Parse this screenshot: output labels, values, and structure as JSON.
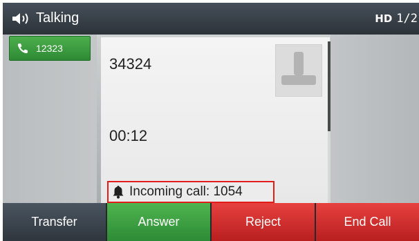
{
  "status_bar": {
    "speaker_icon": "speaker-icon",
    "title": "Talking",
    "hd_label": "HD",
    "page_indicator": "1/2"
  },
  "line_key": {
    "icon": "phone-icon",
    "label": "12323",
    "color": "#3a9d40"
  },
  "call": {
    "callee_number": "34324",
    "duration": "00:12",
    "avatar_icon": "contact-avatar-icon"
  },
  "incoming": {
    "icon": "bell-icon",
    "text": "Incoming call: 1054",
    "highlight_color": "#e21b1b"
  },
  "softkeys": [
    {
      "label": "Transfer",
      "color": "#3a434c"
    },
    {
      "label": "Answer",
      "color": "#3a9d40"
    },
    {
      "label": "Reject",
      "color": "#d12d2b"
    },
    {
      "label": "End Call",
      "color": "#d12d2b"
    }
  ]
}
